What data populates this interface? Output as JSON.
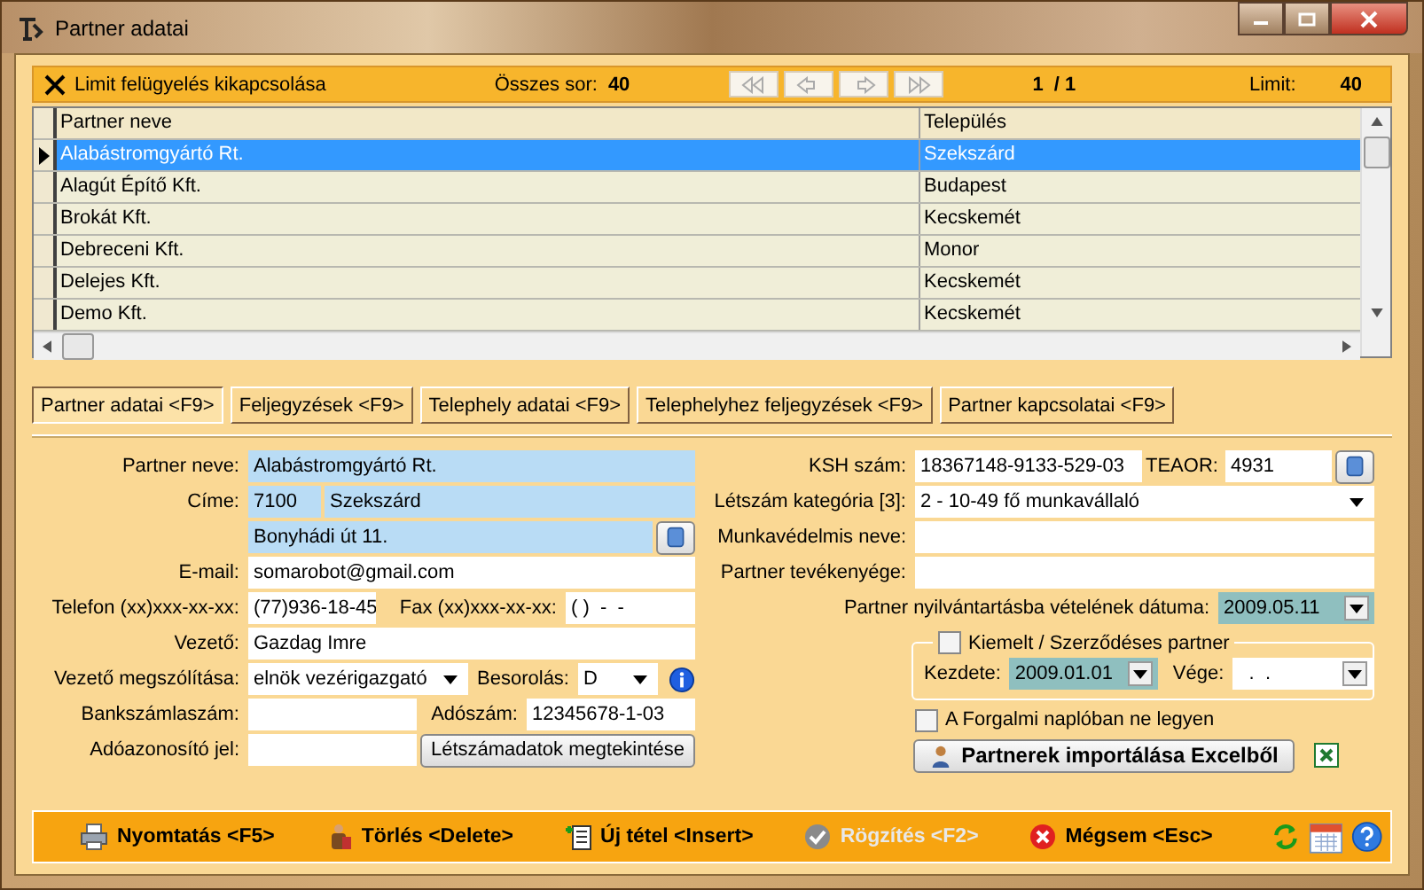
{
  "window": {
    "title": "Partner adatai"
  },
  "limit_bar": {
    "toggle_label": "Limit felügyelés kikapcsolása",
    "total_label": "Összes sor:",
    "total": "40",
    "page": "1  / 1",
    "limit_label": "Limit:",
    "limit": "40"
  },
  "grid": {
    "columns": [
      "Partner neve",
      "Település"
    ],
    "rows": [
      {
        "name": "Alabástromgyártó Rt.",
        "city": "Szekszárd",
        "selected": true
      },
      {
        "name": "Alagút Építő Kft.",
        "city": "Budapest",
        "selected": false
      },
      {
        "name": "Brokát Kft.",
        "city": "Kecskemét",
        "selected": false
      },
      {
        "name": "Debreceni Kft.",
        "city": "Monor",
        "selected": false
      },
      {
        "name": "Delejes Kft.",
        "city": "Kecskemét",
        "selected": false
      },
      {
        "name": "Demo Kft.",
        "city": "Kecskemét",
        "selected": false
      }
    ]
  },
  "tabs": [
    {
      "label": "Partner adatai <F9>",
      "selected": true
    },
    {
      "label": "Feljegyzések <F9>",
      "selected": false
    },
    {
      "label": "Telephely adatai <F9>",
      "selected": false
    },
    {
      "label": "Telephelyhez feljegyzések <F9>",
      "selected": false
    },
    {
      "label": "Partner kapcsolatai <F9>",
      "selected": false
    }
  ],
  "form": {
    "partner_name": {
      "label": "Partner neve:",
      "value": "Alabástromgyártó Rt."
    },
    "address": {
      "label": "Címe:",
      "zip": "7100",
      "city": "Szekszárd",
      "street": "Bonyhádi út 11."
    },
    "email": {
      "label": "E-mail:",
      "value": "somarobot@gmail.com"
    },
    "phone": {
      "label": "Telefon (xx)xxx-xx-xx:",
      "value": "(77)936-18-45"
    },
    "fax": {
      "label": "Fax (xx)xxx-xx-xx:",
      "value": "( )  -  -"
    },
    "manager": {
      "label": "Vezető:",
      "value": "Gazdag Imre"
    },
    "salutation": {
      "label": "Vezető megszólítása:",
      "value": "elnök vezérigazgató"
    },
    "classification": {
      "label": "Besorolás:",
      "value": "D"
    },
    "bank_account": {
      "label": "Bankszámlaszám:"
    },
    "tax_number": {
      "label": "Adószám:",
      "value": "12345678-1-03"
    },
    "tax_id": {
      "label": "Adóazonosító jel:"
    },
    "headcount_button": "Létszámadatok megtekintése",
    "ksh": {
      "label": "KSH szám:",
      "value": "18367148-9133-529-03"
    },
    "teaor": {
      "label": "TEAOR:",
      "value": "4931"
    },
    "headcount_category": {
      "label": "Létszám kategória [3]:",
      "value": "2 - 10-49 fő munkavállaló"
    },
    "safety_name": {
      "label": "Munkavédelmis neve:"
    },
    "activity": {
      "label": "Partner tevékenyége:"
    },
    "registration_date": {
      "label": "Partner nyilvántartásba vételének dátuma:",
      "value": "2009.05.11"
    },
    "contract": {
      "label": "Kiemelt / Szerződéses partner",
      "checked": false,
      "start_label": "Kezdete:",
      "start": "2009.01.01",
      "end_label": "Vége:",
      "end": "  .  ."
    },
    "exclude_from_log": {
      "label": "A Forgalmi naplóban ne legyen",
      "checked": false
    },
    "import_button": "Partnerek importálása Excelből"
  },
  "buttons": [
    {
      "kind": "print",
      "label": "Nyomtatás <F5>",
      "disabled": false
    },
    {
      "kind": "delete",
      "label": "Törlés <Delete>",
      "disabled": false
    },
    {
      "kind": "new",
      "label": "Új tétel <Insert>",
      "disabled": false
    },
    {
      "kind": "save",
      "label": "Rögzítés <F2>",
      "disabled": true
    },
    {
      "kind": "cancel",
      "label": "Mégsem <Esc>",
      "disabled": false
    }
  ]
}
